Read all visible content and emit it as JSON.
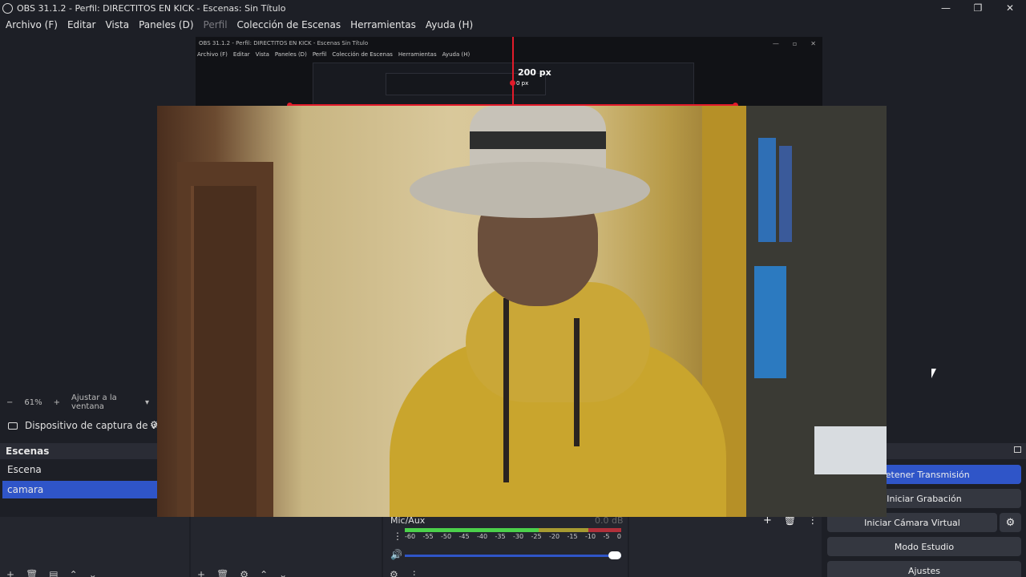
{
  "window": {
    "title": "OBS 31.1.2 - Perfil: DIRECTITOS EN KICK - Escenas: Sin Título",
    "controls": [
      "—",
      "❐",
      "✕"
    ]
  },
  "menu": [
    "Archivo (F)",
    "Editar",
    "Vista",
    "Paneles (D)",
    "Perfil",
    "Colección de Escenas",
    "Herramientas",
    "Ayuda (H)"
  ],
  "nested": {
    "title": "OBS 31.1.2 - Perfil: DIRECTITOS EN KICK - Escenas Sin Título",
    "menu": [
      "Archivo (F)",
      "Editar",
      "Vista",
      "Paneles (D)",
      "Perfil",
      "Colección de Escenas",
      "Herramientas",
      "Ayuda (H)"
    ],
    "measure_label": "200 px",
    "measure_label_small": "0 px"
  },
  "zoom": {
    "minus": "−",
    "value": "61%",
    "plus": "+",
    "fit_label": "Ajustar a la ventana",
    "arrow": "▾"
  },
  "source": {
    "name": "Dispositivo de captura de v",
    "gear": "⚙"
  },
  "scenes": {
    "header": "Escenas",
    "items": [
      {
        "label": "Escena",
        "active": false
      },
      {
        "label": "camara",
        "active": true
      }
    ],
    "toolbar": [
      "+",
      "🗑",
      "▤",
      "⌃",
      "⌄"
    ]
  },
  "sources_toolbar": [
    "+",
    "🗑",
    "⚙",
    "⌃",
    "⌄"
  ],
  "mixer": {
    "name": "Mic/Aux",
    "db": "0.0 dB",
    "ticks": [
      "-60",
      "-55",
      "-50",
      "-45",
      "-40",
      "-35",
      "-30",
      "-25",
      "-20",
      "-15",
      "-10",
      "-5",
      "0"
    ],
    "menu": "⋮",
    "volume_icon": "🔊",
    "volume_level": 1.0,
    "toolbar": [
      "⚙",
      "⋮"
    ]
  },
  "transitions": {
    "icons": [
      "+",
      "🗑",
      "⋮"
    ]
  },
  "controls": {
    "buttons": [
      "Detener Transmisión",
      "Iniciar Grabación",
      "Iniciar Cámara Virtual",
      "Modo Estudio",
      "Ajustes"
    ],
    "gear": "⚙"
  }
}
